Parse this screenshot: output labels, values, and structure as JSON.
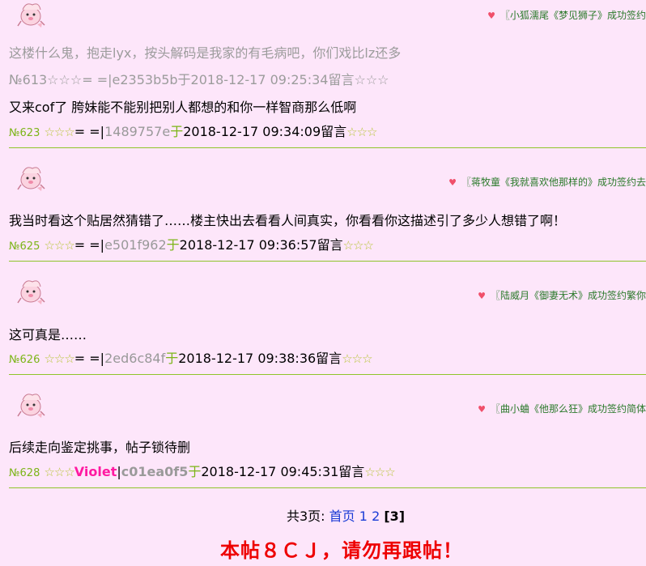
{
  "posts": [
    {
      "ad": "〖小狐濡尾《梦见狮子》成功签约",
      "quote": "这楼什么鬼，抱走lyx，按头解码是我家的有毛病吧，你们戏比lz还多",
      "quote_meta": "№613☆☆☆= =|e2353b5b于2018-12-17 09:25:34留言☆☆☆",
      "body": "又来cof了 胯妹能不能别把别人都想的和你一样智商那么低啊",
      "no": "№623",
      "stars_pre": "☆☆☆",
      "name": "= =|",
      "hash": "1489757e",
      "yu": "于",
      "time": "2018-12-17 09:34:09留言",
      "stars_post": "☆☆☆"
    },
    {
      "ad": "〖蒋牧童《我就喜欢他那样的》成功签约去",
      "body": "我当时看这个贴居然猜错了……楼主快出去看看人间真实，你看看你这描述引了多少人想错了啊！",
      "no": "№625",
      "stars_pre": "☆☆☆",
      "name": "= =|",
      "hash": "e501f962",
      "yu": "于",
      "time": "2018-12-17 09:36:57留言",
      "stars_post": "☆☆☆"
    },
    {
      "ad": "〖陆威月《御妻无术》成功签约繁你",
      "body": "这可真是……",
      "no": "№626",
      "stars_pre": "☆☆☆",
      "name": "= =|",
      "hash": "2ed6c84f",
      "yu": "于",
      "time": "2018-12-17 09:38:36留言",
      "stars_post": "☆☆☆"
    },
    {
      "ad": "〖曲小蛐《他那么狂》成功签约简体",
      "body": "后续走向鉴定挑事，帖子锁待删",
      "no": "№628",
      "stars_pre": "☆☆☆",
      "name": "Violet",
      "sep": "|",
      "hash": "c01ea0f5",
      "yu": "于",
      "time": "2018-12-17 09:45:31留言",
      "stars_post": "☆☆☆"
    }
  ],
  "pager": {
    "total": "共3页:",
    "first": "首页",
    "p1": "1",
    "p2": "2",
    "current": "[3]"
  },
  "notice": "本帖８ＣＪ，请勿再跟帖！",
  "colors": {
    "background": "#fde6fa",
    "accent": "#7cb518",
    "link": "#1a3bd6",
    "notice": "#ee0000",
    "name_highlight": "#ff1aa1"
  }
}
